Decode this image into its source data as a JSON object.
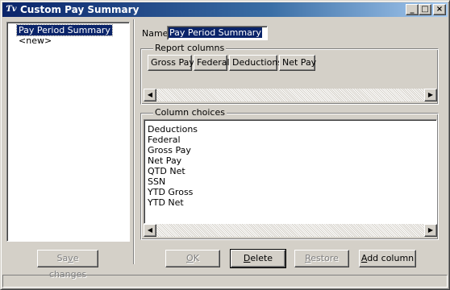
{
  "window": {
    "title": "Custom Pay Summary",
    "icon": "app-icon",
    "controls": {
      "minimize": "_",
      "maximize": "□",
      "close": "×"
    }
  },
  "left_panel": {
    "items": [
      {
        "label": "Pay Period Summary",
        "selected": true
      },
      {
        "label": "<new>",
        "selected": false
      }
    ],
    "save_button": {
      "label_pre": "Sa",
      "label_u": "v",
      "label_post": "e changes",
      "enabled": false
    }
  },
  "name_field": {
    "label": "Name",
    "value": "Pay Period Summary"
  },
  "report_columns": {
    "label": "Report columns",
    "columns": [
      "Gross Pay",
      "Federal",
      "Deductions",
      "Net Pay"
    ]
  },
  "column_choices": {
    "label": "Column choices",
    "items": [
      "Deductions",
      "Federal",
      "Gross Pay",
      "Net Pay",
      "QTD Net",
      "SSN",
      "YTD Gross",
      "YTD Net"
    ]
  },
  "buttons": {
    "ok": {
      "label_u": "O",
      "label_post": "K",
      "enabled": false
    },
    "delete": {
      "label_u": "D",
      "label_post": "elete",
      "enabled": true
    },
    "restore": {
      "label_u": "R",
      "label_post": "estore",
      "enabled": false
    },
    "add_column": {
      "label_u": "A",
      "label_post": "dd column",
      "enabled": true
    }
  },
  "scroll_arrows": {
    "left": "◀",
    "right": "▶"
  }
}
